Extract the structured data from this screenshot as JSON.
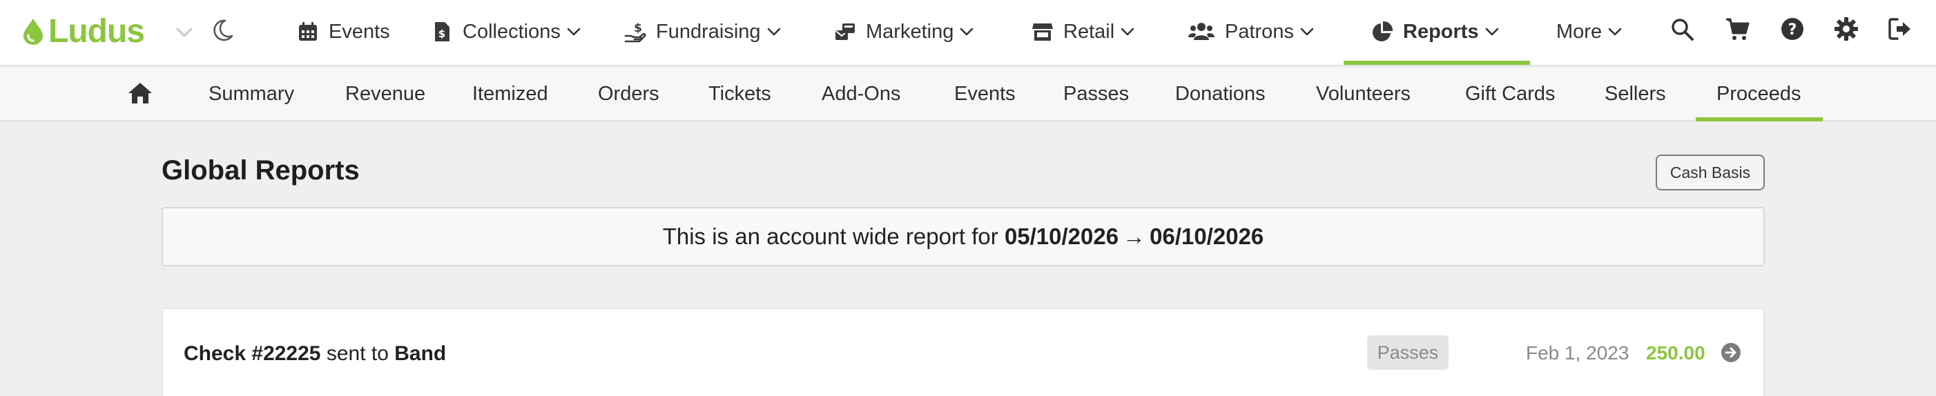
{
  "brand": {
    "name": "Ludus",
    "color": "#8cc63f"
  },
  "icons": {
    "logo": "water-drop-icon",
    "theme": "moon-icon",
    "search": "search-icon",
    "cart": "cart-icon",
    "help": "question-circle-icon",
    "settings": "gear-icon",
    "logout": "sign-out-icon",
    "home": "home-icon"
  },
  "nav": {
    "items": [
      {
        "label": "Events",
        "icon": "calendar-icon",
        "dropdown": false
      },
      {
        "label": "Collections",
        "icon": "receipt-icon",
        "dropdown": true
      },
      {
        "label": "Fundraising",
        "icon": "hand-donate-icon",
        "dropdown": true
      },
      {
        "label": "Marketing",
        "icon": "mail-bulk-icon",
        "dropdown": true
      },
      {
        "label": "Retail",
        "icon": "store-icon",
        "dropdown": true
      },
      {
        "label": "Patrons",
        "icon": "users-icon",
        "dropdown": true
      },
      {
        "label": "Reports",
        "icon": "pie-chart-icon",
        "dropdown": true,
        "active": true
      },
      {
        "label": "More",
        "icon": "",
        "dropdown": true
      }
    ]
  },
  "subnav": {
    "items": [
      "Summary",
      "Revenue",
      "Itemized",
      "Orders",
      "Tickets",
      "Add-Ons",
      "Events",
      "Passes",
      "Donations",
      "Volunteers",
      "Gift Cards",
      "Sellers",
      "Proceeds"
    ],
    "active": "Proceeds"
  },
  "page": {
    "title": "Global Reports",
    "basis_button": "Cash Basis",
    "range_prefix": "This is an account wide report for",
    "range_start": "05/10/2026",
    "range_arrow": "→",
    "range_end": "06/10/2026"
  },
  "proceeds": [
    {
      "check_label": "Check #22225",
      "sent_to_text": "sent to",
      "recipient": "Band",
      "category": "Passes",
      "date": "Feb 1, 2023",
      "amount": "250.00"
    }
  ]
}
